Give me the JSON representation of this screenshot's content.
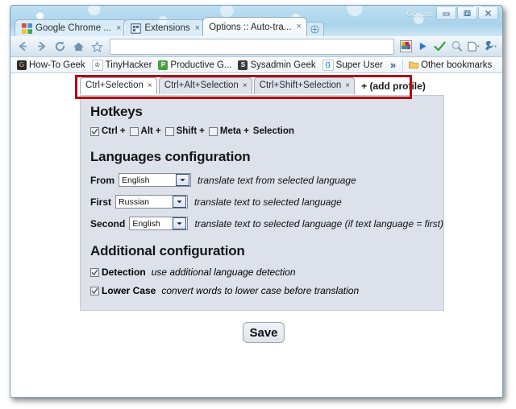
{
  "window": {
    "watermark": "Google",
    "controls": [
      {
        "name": "minimize",
        "label": "Minimize"
      },
      {
        "name": "maximize",
        "label": "Maximize"
      },
      {
        "name": "close",
        "label": "Close"
      }
    ]
  },
  "browser": {
    "tabs": [
      {
        "title": "Google Chrome ...",
        "icon": "chrome-icon",
        "active": false,
        "close": "×"
      },
      {
        "title": "Extensions",
        "icon": "extensions-icon",
        "active": false,
        "close": "×"
      },
      {
        "title": "Options :: Auto-tra...",
        "icon": "options-icon",
        "active": true,
        "close": "×"
      }
    ],
    "new_tab_label": "+",
    "toolbar": {
      "back": "←",
      "forward": "→",
      "reload": "↻",
      "home": "⌂",
      "bookmark_star": "☆",
      "omnibox_value": "",
      "omnibox_placeholder": "",
      "extensions": [
        {
          "name": "color-squares-extension-icon"
        },
        {
          "name": "play-extension-icon"
        },
        {
          "name": "checkmark-extension-icon"
        },
        {
          "name": "magnifier-extension-icon"
        },
        {
          "name": "page-menu-icon"
        },
        {
          "name": "wrench-menu-icon"
        }
      ]
    },
    "bookmarks": [
      {
        "label": "How-To Geek",
        "icon": "howtogeek-icon"
      },
      {
        "label": "TinyHacker",
        "icon": "tinyhacker-icon"
      },
      {
        "label": "Productive G...",
        "icon": "productive-geek-icon"
      },
      {
        "label": "Sysadmin Geek",
        "icon": "sysadmin-geek-icon"
      },
      {
        "label": "Super User",
        "icon": "superuser-icon"
      }
    ],
    "bookmarks_overflow": "»",
    "other_bookmarks": {
      "label": "Other bookmarks",
      "icon": "folder-icon"
    }
  },
  "page": {
    "profile_tabs": [
      {
        "label": "Ctrl+Selection",
        "active": true,
        "close": "×"
      },
      {
        "label": "Ctrl+Alt+Selection",
        "active": false,
        "close": "×"
      },
      {
        "label": "Ctrl+Shift+Selection",
        "active": false,
        "close": "×"
      }
    ],
    "add_profile_label": "+ (add profile)",
    "hotkeys": {
      "heading": "Hotkeys",
      "modifiers": [
        {
          "label": "Ctrl",
          "checked": true,
          "separator": "+"
        },
        {
          "label": "Alt",
          "checked": false,
          "separator": "+"
        },
        {
          "label": "Shift",
          "checked": false,
          "separator": "+"
        },
        {
          "label": "Meta",
          "checked": false,
          "separator": "+"
        }
      ],
      "trailing": "Selection"
    },
    "languages": {
      "heading": "Languages configuration",
      "rows": [
        {
          "label": "From",
          "value": "English",
          "description": "translate text from selected language"
        },
        {
          "label": "First",
          "value": "Russian",
          "description": "translate text to selected language"
        },
        {
          "label": "Second",
          "value": "English",
          "description": "translate text to selected language (if text language = first)"
        }
      ]
    },
    "additional": {
      "heading": "Additional configuration",
      "options": [
        {
          "label": "Detection",
          "description": "use additional language detection",
          "checked": true
        },
        {
          "label": "Lower Case",
          "description": "convert words to lower case before translation",
          "checked": true
        }
      ]
    },
    "save_label": "Save"
  },
  "colors": {
    "annotation": "#b00f11",
    "panel_bg": "#dde1ea",
    "theme_blue": "#a9d3ea"
  }
}
